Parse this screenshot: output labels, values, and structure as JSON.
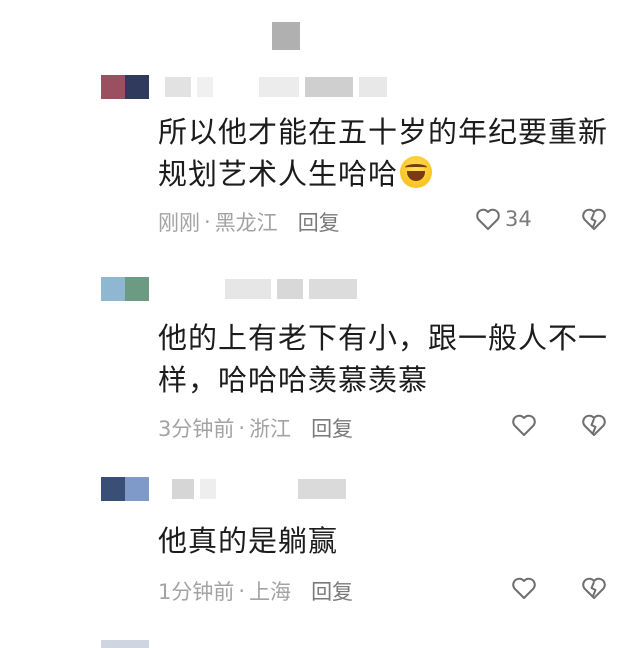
{
  "comments": [
    {
      "text_line1": "所以他才能在五十岁的年纪要重新",
      "text_line2": "规划艺术人生哈哈",
      "emoji": "rolling-laughing-emoji",
      "time": "刚刚",
      "location": "黑龙江",
      "reply_label": "回复",
      "like_count": "34"
    },
    {
      "text_line1": "他的上有老下有小，跟一般人不一",
      "text_line2": "样，哈哈哈羡慕羡慕",
      "time": "3分钟前",
      "location": "浙江",
      "reply_label": "回复"
    },
    {
      "text_line1": "他真的是躺赢",
      "time": "1分钟前",
      "location": "上海",
      "reply_label": "回复"
    }
  ],
  "meta_separator": "·",
  "icons": {
    "like": "heart-outline-icon",
    "dislike": "broken-heart-icon"
  },
  "colors": {
    "text": "#1c1c1c",
    "meta": "#a3a3a3",
    "icon": "#6f6f6f"
  }
}
